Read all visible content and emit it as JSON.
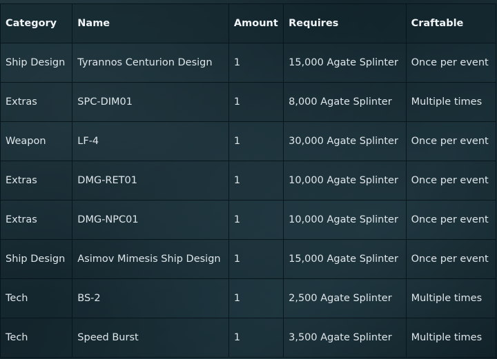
{
  "table": {
    "headers": {
      "category": "Category",
      "name": "Name",
      "amount": "Amount",
      "requires": "Requires",
      "craftable": "Craftable"
    },
    "rows": [
      {
        "category": "Ship Design",
        "name": "Tyrannos Centurion Design",
        "amount": "1",
        "requires": "15,000 Agate Splinter",
        "craftable": "Once per event"
      },
      {
        "category": "Extras",
        "name": "SPC-DIM01",
        "amount": "1",
        "requires": "8,000 Agate Splinter",
        "craftable": "Multiple times"
      },
      {
        "category": "Weapon",
        "name": "LF-4",
        "amount": "1",
        "requires": "30,000 Agate Splinter",
        "craftable": "Once per event"
      },
      {
        "category": "Extras",
        "name": "DMG-RET01",
        "amount": "1",
        "requires": "10,000 Agate Splinter",
        "craftable": "Once per event"
      },
      {
        "category": "Extras",
        "name": "DMG-NPC01",
        "amount": "1",
        "requires": "10,000 Agate Splinter",
        "craftable": "Once per event"
      },
      {
        "category": "Ship Design",
        "name": "Asimov Mimesis Ship Design",
        "amount": "1",
        "requires": "15,000 Agate Splinter",
        "craftable": "Once per event"
      },
      {
        "category": "Tech",
        "name": "BS-2",
        "amount": "1",
        "requires": "2,500 Agate Splinter",
        "craftable": "Multiple times"
      },
      {
        "category": "Tech",
        "name": "Speed Burst",
        "amount": "1",
        "requires": "3,500 Agate Splinter",
        "craftable": "Multiple times"
      }
    ]
  }
}
